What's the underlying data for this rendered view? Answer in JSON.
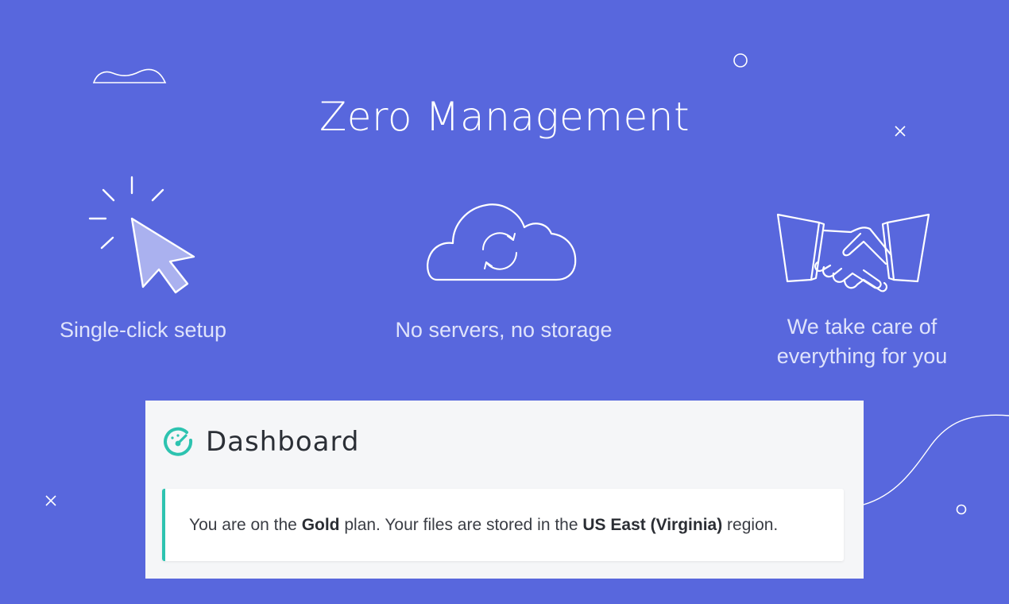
{
  "hero": {
    "title": "Zero Management"
  },
  "features": [
    {
      "label": "Single-click setup",
      "icon": "cursor-click-icon"
    },
    {
      "label": "No servers, no storage",
      "icon": "cloud-sync-icon"
    },
    {
      "label_line1": "We take care of",
      "label_line2": "everything for you",
      "icon": "handshake-icon"
    }
  ],
  "dashboard": {
    "title": "Dashboard",
    "icon": "speedometer-icon",
    "alert": {
      "prefix": "You are on the ",
      "plan": "Gold",
      "middle": " plan. Your files are stored in the ",
      "region": "US East (Virginia)",
      "suffix": " region."
    }
  },
  "colors": {
    "background": "#5867dd",
    "accent": "#2dc3b0",
    "panel": "#f5f6f8"
  }
}
